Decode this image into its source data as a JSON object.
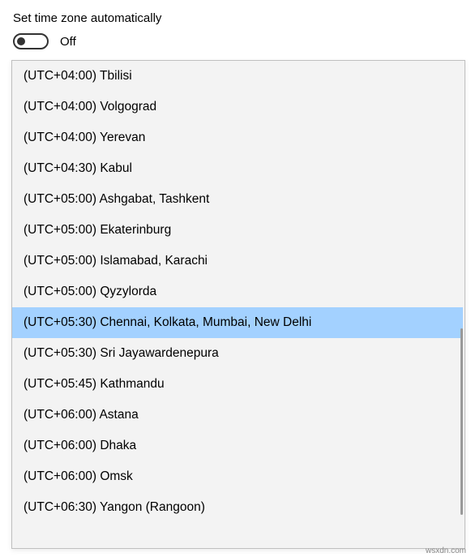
{
  "setting": {
    "label": "Set time zone automatically",
    "toggle_state": "Off",
    "toggle_on": false
  },
  "timezone_list": {
    "selected_index": 8,
    "items": [
      "(UTC+04:00) Tbilisi",
      "(UTC+04:00) Volgograd",
      "(UTC+04:00) Yerevan",
      "(UTC+04:30) Kabul",
      "(UTC+05:00) Ashgabat, Tashkent",
      "(UTC+05:00) Ekaterinburg",
      "(UTC+05:00) Islamabad, Karachi",
      "(UTC+05:00) Qyzylorda",
      "(UTC+05:30) Chennai, Kolkata, Mumbai, New Delhi",
      "(UTC+05:30) Sri Jayawardenepura",
      "(UTC+05:45) Kathmandu",
      "(UTC+06:00) Astana",
      "(UTC+06:00) Dhaka",
      "(UTC+06:00) Omsk",
      "(UTC+06:30) Yangon (Rangoon)"
    ]
  },
  "watermark": "wsxdn.com"
}
